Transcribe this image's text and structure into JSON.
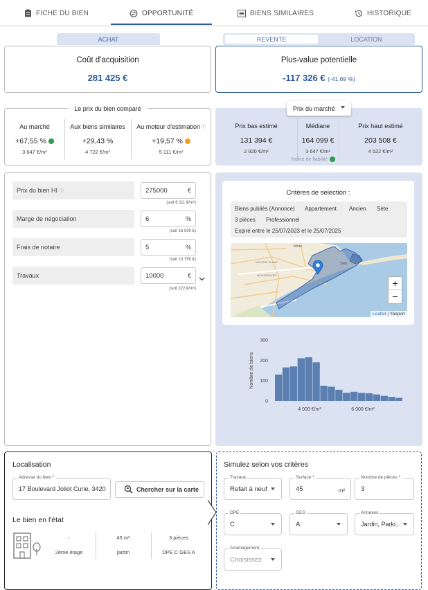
{
  "nav": {
    "tabs": [
      {
        "label": "FICHE DU BIEN",
        "icon": "clipboard-icon"
      },
      {
        "label": "OPPORTUNITÉ",
        "icon": "exchange-icon"
      },
      {
        "label": "BIENS SIMILAIRES",
        "icon": "list-icon"
      },
      {
        "label": "HISTORIQUE",
        "icon": "history-icon"
      }
    ],
    "active": "OPPORTUNITÉ"
  },
  "toggles": {
    "left": {
      "achat": "ACHAT"
    },
    "right": {
      "revente": "REVENTE",
      "location": "LOCATION",
      "selected": "REVENTE"
    }
  },
  "acquisition": {
    "title": "Coût d'acquisition",
    "value": "281 425 €"
  },
  "plusvalue": {
    "title": "Plus-value potentielle",
    "value": "-117 326 €",
    "pct": "(-41,69 %)"
  },
  "compare": {
    "title": "Le prix du bien comparé",
    "cols": [
      {
        "label": "Au marché",
        "pct": "+67,55 %",
        "sqm": "3 647 €/m²",
        "dot": "#2e9a4e"
      },
      {
        "label": "Aux biens similaires",
        "pct": "+29,43 %",
        "sqm": "4 722 €/m²",
        "dot": ""
      },
      {
        "label": "Au moteur d'estimation",
        "pct": "+19,57 %",
        "sqm": "5 111 €/m²",
        "dot": "#f2a21c"
      }
    ]
  },
  "market": {
    "dropdown": "Prix du marché",
    "cols": [
      {
        "label": "Prix bas estimé",
        "value": "131 394 €",
        "sqm": "2 920 €/m²"
      },
      {
        "label": "Médiane",
        "value": "164 099 €",
        "sqm": "3 647 €/m²"
      },
      {
        "label": "Prix haut estimé",
        "value": "203 508 €",
        "sqm": "4 522 €/m²"
      }
    ],
    "reliability": "Indice de fiabilité",
    "reliability_color": "#2e9a4e"
  },
  "form": {
    "rows": [
      {
        "label": "Prix du bien HI",
        "value": "275000",
        "unit": "€",
        "hint": "(soit 6 111 €/m²)"
      },
      {
        "label": "Marge de négociation",
        "value": "6",
        "unit": "%",
        "hint": "(soit 16 500 €)"
      },
      {
        "label": "Frais de notaire",
        "value": "5",
        "unit": "%",
        "hint": "(soit 13 750 €)"
      },
      {
        "label": "Travaux",
        "value": "10000",
        "unit": "€",
        "hint": "(soit 222 €/m²)"
      }
    ]
  },
  "criteria": {
    "title": "Critères de selection :",
    "chips_row1": [
      "Biens publiés (Annonce)",
      "Appartement",
      "Ancien",
      "Sète"
    ],
    "chips_row2": [
      "3 pièces",
      "Professionnel"
    ],
    "date_range": "Expiré entre le 25/07/2023 et le 25/07/2025",
    "map": {
      "labels": [
        "Mèze",
        "Sète",
        "MOURRE BLANC",
        "MONTPENYER"
      ],
      "zoom_in": "+",
      "zoom_out": "−",
      "attribution_link": "Leaflet",
      "attribution_sep": " | ",
      "attribution_text": "Yanport"
    }
  },
  "chart_data": {
    "type": "bar",
    "ylabel": "Nombre de biens",
    "yticks": [
      0,
      100,
      200,
      300
    ],
    "ylim": [
      0,
      300
    ],
    "xtick_labels": [
      "4 000 €/m²",
      "6 000 €/m²"
    ],
    "values": [
      130,
      165,
      170,
      210,
      215,
      190,
      75,
      70,
      55,
      40,
      45,
      40,
      38,
      32,
      25,
      20,
      15,
      25
    ],
    "color": "#5b7fb0"
  },
  "localisation": {
    "title": "Localisation",
    "address_label": "Adresse du bien *",
    "address_value": "17 Boulevard Joliot Curie, 3420",
    "search_button": "Chercher sur la carte"
  },
  "etat": {
    "title": "Le bien en l'état",
    "cells": [
      {
        "top": "-",
        "bottom": "2ème étage"
      },
      {
        "top": "45 m²",
        "bottom": "jardin"
      },
      {
        "top": "3 pièces",
        "bottom": "DPE C  GES A"
      }
    ]
  },
  "simulate": {
    "title": "Simulez selon vos critères",
    "fields": [
      {
        "label": "Travaux",
        "value": "Refait à neuf",
        "type": "select"
      },
      {
        "label": "Surface *",
        "value": "45",
        "unit": "m²",
        "type": "input"
      },
      {
        "label": "Nombre de pièces *",
        "value": "3",
        "type": "input"
      },
      {
        "label": "DPE",
        "value": "C",
        "type": "select"
      },
      {
        "label": "GES",
        "value": "A",
        "type": "select"
      },
      {
        "label": "Annexes",
        "value": "Jardin, Parki...",
        "type": "select"
      },
      {
        "label": "Aménagement",
        "value": "Choisissez",
        "type": "select",
        "placeholder": true
      }
    ]
  },
  "colors": {
    "accent": "#2b5a9a",
    "panel": "#dbe2f1"
  }
}
